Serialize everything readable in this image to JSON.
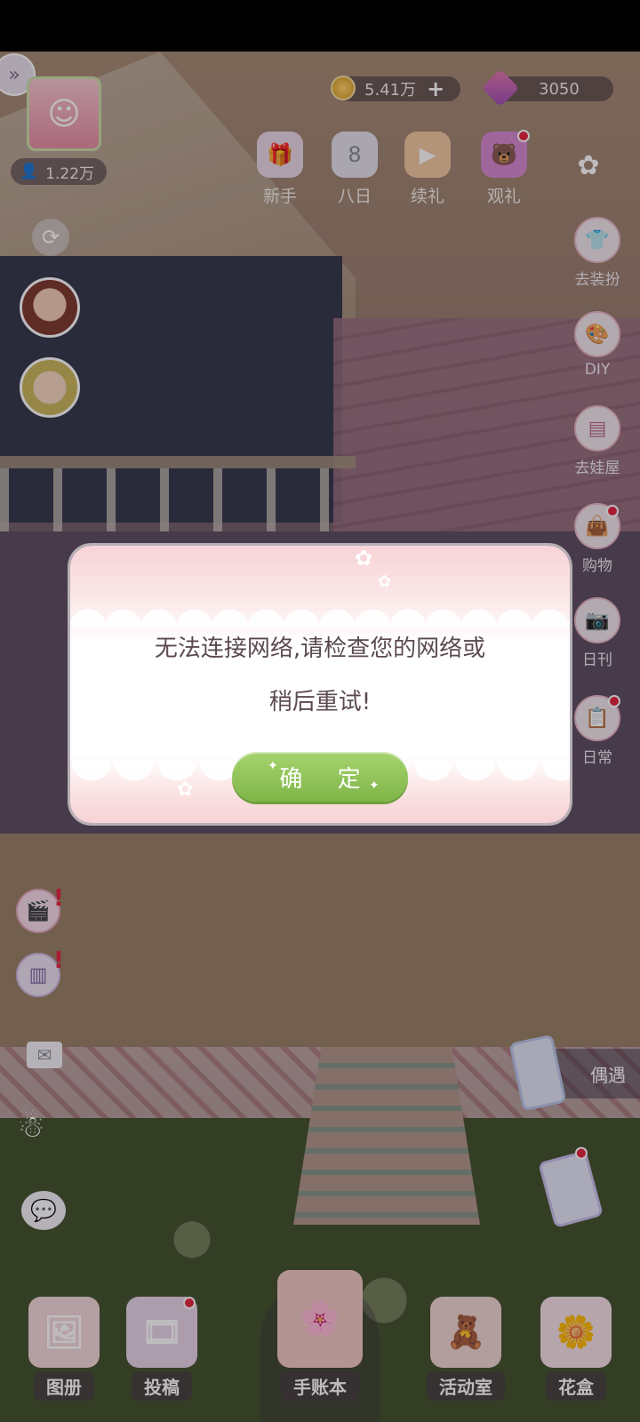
{
  "top": {
    "followers": "1.22万",
    "coins": "5.41万",
    "gems": "3050"
  },
  "top_icons": [
    {
      "label": "新手",
      "icon": "gift-box-icon"
    },
    {
      "label": "八日",
      "icon": "eight-day-icon"
    },
    {
      "label": "续礼",
      "icon": "tv-gift-icon"
    },
    {
      "label": "观礼",
      "icon": "bear-icon"
    }
  ],
  "side_menu": [
    {
      "label": "去装扮",
      "icon": "dress-icon"
    },
    {
      "label": "DIY",
      "icon": "palette-icon"
    },
    {
      "label": "去娃屋",
      "icon": "cabinet-icon"
    },
    {
      "label": "购物",
      "icon": "shopping-bag-icon"
    },
    {
      "label": "日刊",
      "icon": "camera-icon"
    },
    {
      "label": "日常",
      "icon": "clipboard-icon"
    }
  ],
  "encounter": {
    "label": "偶遇"
  },
  "dialog": {
    "message_line1": "无法连接网络,请检查您的网络或",
    "message_line2": "稍后重试!",
    "ok_label": "确 定"
  },
  "bottom_nav": [
    {
      "label": "图册",
      "icon": "album-icon"
    },
    {
      "label": "投稿",
      "icon": "film-icon"
    },
    {
      "label": "手账本",
      "icon": "notebook-icon"
    },
    {
      "label": "活动室",
      "icon": "teddy-bear-icon"
    },
    {
      "label": "花盒",
      "icon": "flower-box-icon"
    }
  ],
  "colors": {
    "ok_button": "#8fc45a",
    "badge": "#e2233d",
    "dialog_text": "#5b4a4f"
  }
}
